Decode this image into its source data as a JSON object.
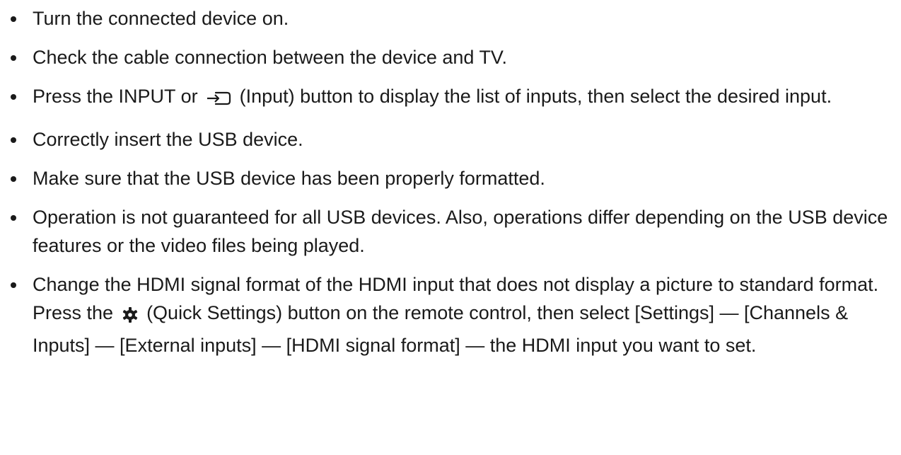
{
  "items": [
    {
      "text": "Turn the connected device on."
    },
    {
      "text": "Check the cable connection between the device and TV."
    },
    {
      "before": "Press the INPUT or ",
      "icon": "input-icon",
      "after": " (Input) button to display the list of inputs, then select the desired input."
    },
    {
      "text": "Correctly insert the USB device."
    },
    {
      "text": "Make sure that the USB device has been properly formatted."
    },
    {
      "text": "Operation is not guaranteed for all USB devices. Also, operations differ depending on the USB device features or the video files being played."
    },
    {
      "before": "Change the HDMI signal format of the HDMI input that does not display a picture to standard format. Press the ",
      "icon": "gear-icon",
      "after": " (Quick Settings) button on the remote control, then select [Settings] — [Channels & Inputs] — [External inputs] — [HDMI signal format] — the HDMI input you want to set."
    }
  ]
}
